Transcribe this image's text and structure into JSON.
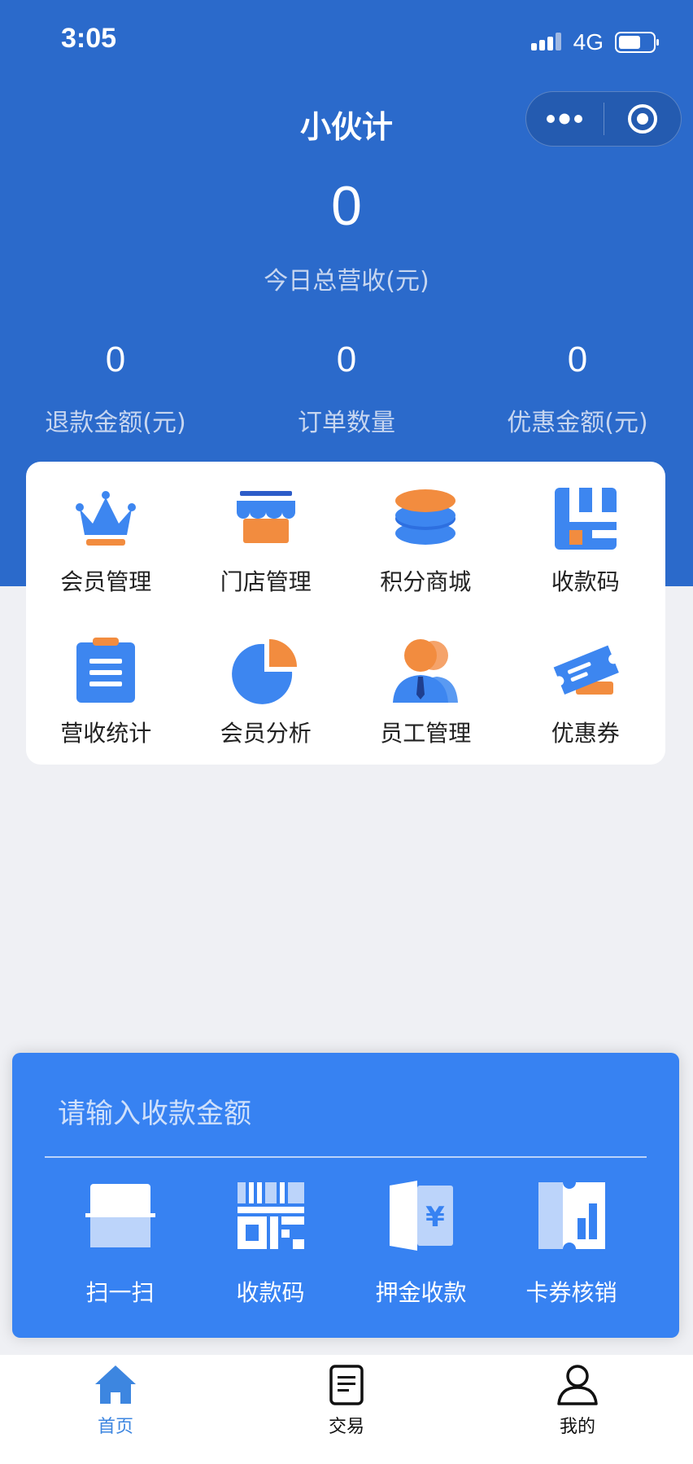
{
  "status_bar": {
    "time": "3:05",
    "network": "4G"
  },
  "nav": {
    "title": "小伙计",
    "more_icon": "more-dots-icon",
    "close_icon": "target-icon"
  },
  "summary": {
    "total_value": "0",
    "total_label": "今日总营收(元)",
    "stats": [
      {
        "value": "0",
        "label": "退款金额(元)"
      },
      {
        "value": "0",
        "label": "订单数量"
      },
      {
        "value": "0",
        "label": "优惠金额(元)"
      }
    ]
  },
  "menu": {
    "items": [
      {
        "label": "会员管理",
        "icon": "crown-icon"
      },
      {
        "label": "门店管理",
        "icon": "storefront-icon"
      },
      {
        "label": "积分商城",
        "icon": "coin-stack-icon"
      },
      {
        "label": "收款码",
        "icon": "payment-code-icon"
      },
      {
        "label": "营收统计",
        "icon": "clipboard-icon"
      },
      {
        "label": "会员分析",
        "icon": "pie-chart-icon"
      },
      {
        "label": "员工管理",
        "icon": "staff-icon"
      },
      {
        "label": "优惠券",
        "icon": "ticket-icon"
      }
    ]
  },
  "payment": {
    "placeholder": "请输入收款金额",
    "actions": [
      {
        "label": "扫一扫",
        "icon": "scan-icon"
      },
      {
        "label": "收款码",
        "icon": "qr-code-icon"
      },
      {
        "label": "押金收款",
        "icon": "deposit-icon"
      },
      {
        "label": "卡券核销",
        "icon": "card-verify-icon"
      }
    ]
  },
  "tabbar": {
    "tabs": [
      {
        "label": "首页",
        "icon": "home-icon",
        "active": true
      },
      {
        "label": "交易",
        "icon": "document-icon",
        "active": false
      },
      {
        "label": "我的",
        "icon": "user-icon",
        "active": false
      }
    ]
  },
  "colors": {
    "header_blue": "#2b6acb",
    "panel_blue": "#3782f2",
    "icon_blue": "#3d86f0",
    "icon_orange": "#f28c3f"
  }
}
